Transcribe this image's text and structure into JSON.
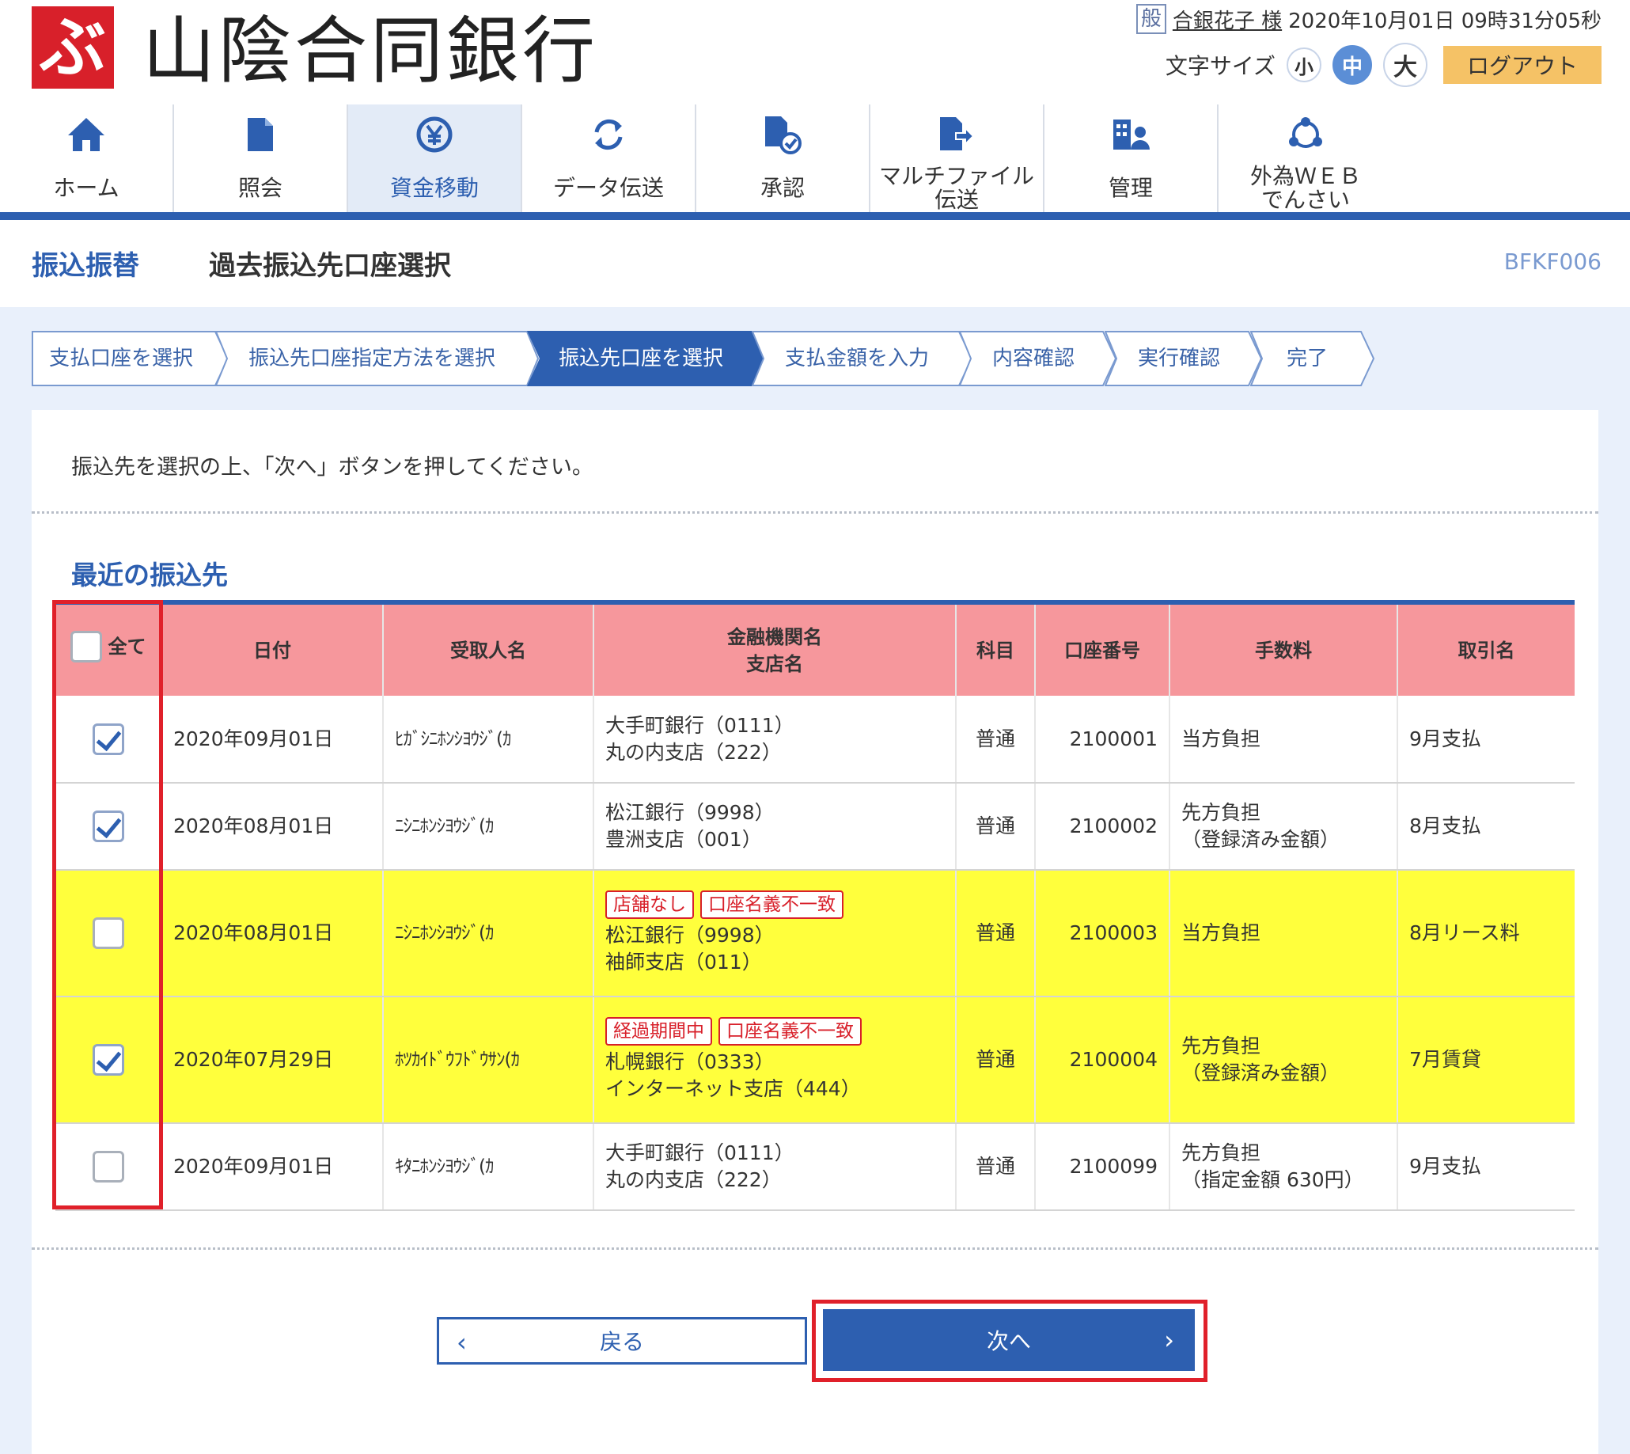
{
  "header": {
    "bank_name": "山陰合同銀行",
    "logo_glyph": "ぶ",
    "user_badge": "般",
    "user_name": "合銀花子 様",
    "datetime": "2020年10月01日 09時31分05秒",
    "font_size_label": "文字サイズ",
    "font_small": "小",
    "font_medium": "中",
    "font_large": "大",
    "logout": "ログアウト"
  },
  "nav": [
    {
      "label": "ホーム",
      "icon": "home-icon"
    },
    {
      "label": "照会",
      "icon": "document-icon"
    },
    {
      "label": "資金移動",
      "icon": "yen-transfer-icon"
    },
    {
      "label": "データ伝送",
      "icon": "sync-icon"
    },
    {
      "label": "承認",
      "icon": "approve-document-icon"
    },
    {
      "label": "マルチファイル\n伝送",
      "icon": "file-transfer-icon"
    },
    {
      "label": "管理",
      "icon": "admin-icon"
    },
    {
      "label": "外為ＷＥＢ\nでんさい",
      "icon": "network-icon"
    }
  ],
  "title": {
    "main": "振込振替",
    "sub": "過去振込先口座選択",
    "screen_id": "BFKF006"
  },
  "steps": [
    "支払口座を選択",
    "振込先口座指定方法を選択",
    "振込先口座を選択",
    "支払金額を入力",
    "内容確認",
    "実行確認",
    "完了"
  ],
  "instruction": "振込先を選択の上、「次へ」ボタンを押してください。",
  "section_title": "最近の振込先",
  "table": {
    "headers": {
      "all": "全て",
      "date": "日付",
      "payee": "受取人名",
      "bank_line1": "金融機関名",
      "bank_line2": "支店名",
      "type": "科目",
      "account": "口座番号",
      "fee": "手数料",
      "trade": "取引名"
    },
    "rows": [
      {
        "checked": true,
        "warn": false,
        "tags": [],
        "date": "2020年09月01日",
        "payee": "ﾋｶﾞｼﾆﾎﾝｼﾖｳｼﾞ(ｶ",
        "bank": "大手町銀行（0111）",
        "branch": "丸の内支店（222）",
        "type": "普通",
        "account": "2100001",
        "fee1": "当方負担",
        "fee2": "",
        "trade": "9月支払"
      },
      {
        "checked": true,
        "warn": false,
        "tags": [],
        "date": "2020年08月01日",
        "payee": "ﾆｼﾆﾎﾝｼﾖｳｼﾞ(ｶ",
        "bank": "松江銀行（9998）",
        "branch": "豊洲支店（001）",
        "type": "普通",
        "account": "2100002",
        "fee1": "先方負担",
        "fee2": "（登録済み金額）",
        "trade": "8月支払"
      },
      {
        "checked": false,
        "warn": true,
        "tags": [
          "店舗なし",
          "口座名義不一致"
        ],
        "date": "2020年08月01日",
        "payee": "ﾆｼﾆﾎﾝｼﾖｳｼﾞ(ｶ",
        "bank": "松江銀行（9998）",
        "branch": "袖師支店（011）",
        "type": "普通",
        "account": "2100003",
        "fee1": "当方負担",
        "fee2": "",
        "trade": "8月リース料"
      },
      {
        "checked": true,
        "warn": true,
        "tags": [
          "経過期間中",
          "口座名義不一致"
        ],
        "date": "2020年07月29日",
        "payee": "ﾎﾂｶｲﾄﾞｳﾌﾄﾞｳｻﾝ(ｶ",
        "bank": "札幌銀行（0333）",
        "branch": "インターネット支店（444）",
        "type": "普通",
        "account": "2100004",
        "fee1": "先方負担",
        "fee2": "（登録済み金額）",
        "trade": "7月賃貸"
      },
      {
        "checked": false,
        "warn": false,
        "tags": [],
        "date": "2020年09月01日",
        "payee": "ｷﾀﾆﾎﾝｼﾖｳｼﾞ(ｶ",
        "bank": "大手町銀行（0111）",
        "branch": "丸の内支店（222）",
        "type": "普通",
        "account": "2100099",
        "fee1": "先方負担",
        "fee2": "（指定金額 630円）",
        "trade": "9月支払"
      }
    ]
  },
  "buttons": {
    "back": "戻る",
    "next": "次へ",
    "back_arrow": "‹",
    "next_arrow": "›"
  },
  "colors": {
    "brand_red": "#d8202a",
    "primary_blue": "#2d5fb0",
    "header_pink": "#f6979c",
    "warn_yellow": "#ffff3c",
    "logout_orange": "#f5c266"
  }
}
